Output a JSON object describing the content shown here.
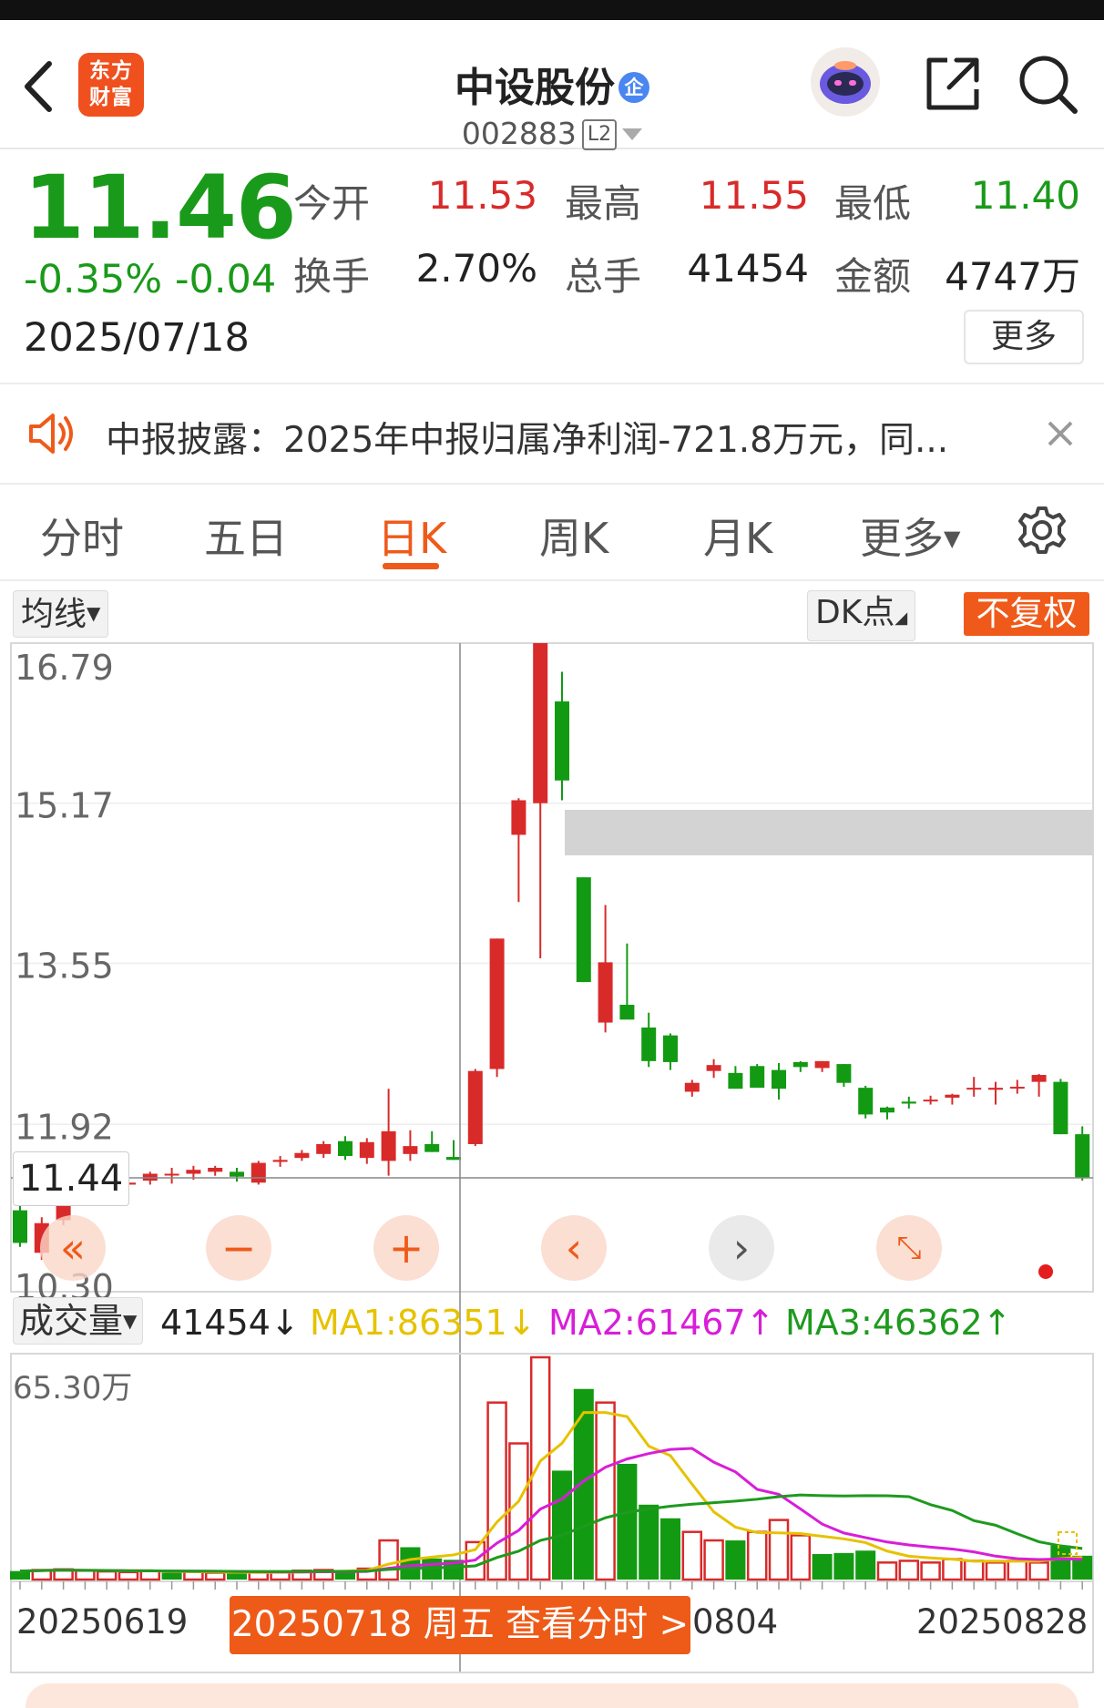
{
  "header": {
    "title": "中设股份",
    "title_badge": "企",
    "code": "002883",
    "level": "L2",
    "logo_text": "东方财富"
  },
  "quote": {
    "price": "11.46",
    "change_pct": "-0.35%",
    "change": "-0.04",
    "date": "2025/07/18",
    "open_label": "今开",
    "open": "11.53",
    "high_label": "最高",
    "high": "11.55",
    "low_label": "最低",
    "low": "11.40",
    "turnover_label": "换手",
    "turnover": "2.70%",
    "volume_label": "总手",
    "volume": "41454",
    "amount_label": "金额",
    "amount": "4747万",
    "more_label": "更多"
  },
  "notice": {
    "text": "中报披露：2025年中报归属净利润-721.8万元，同..."
  },
  "tabs": [
    "分时",
    "五日",
    "日K",
    "周K",
    "月K",
    "更多"
  ],
  "active_tab": "日K",
  "toolbar": {
    "ma_select": "均线",
    "dk_label": "DK点",
    "adjust_label": "不复权"
  },
  "chart_data": {
    "type": "candlestick",
    "y_ticks": [
      "16.79",
      "15.17",
      "13.55",
      "11.92",
      "10.30"
    ],
    "ylim": [
      10.3,
      16.79
    ],
    "crosshair_value": "11.44",
    "crosshair_date": "20250718 周五 查看分时 >",
    "x_labels": [
      "20250619",
      "0804",
      "20250828"
    ],
    "candles": [
      {
        "o": 11.05,
        "h": 11.12,
        "l": 10.68,
        "c": 10.72
      },
      {
        "o": 10.62,
        "h": 10.98,
        "l": 10.55,
        "c": 10.92
      },
      {
        "o": 10.95,
        "h": 11.32,
        "l": 10.9,
        "c": 11.28
      },
      {
        "o": 11.26,
        "h": 11.38,
        "l": 11.18,
        "c": 11.3
      },
      {
        "o": 11.3,
        "h": 11.36,
        "l": 11.25,
        "c": 11.3
      },
      {
        "o": 11.31,
        "h": 11.36,
        "l": 11.26,
        "c": 11.33
      },
      {
        "o": 11.35,
        "h": 11.44,
        "l": 11.31,
        "c": 11.42
      },
      {
        "o": 11.42,
        "h": 11.48,
        "l": 11.32,
        "c": 11.42
      },
      {
        "o": 11.42,
        "h": 11.5,
        "l": 11.36,
        "c": 11.46
      },
      {
        "o": 11.44,
        "h": 11.5,
        "l": 11.4,
        "c": 11.48
      },
      {
        "o": 11.44,
        "h": 11.48,
        "l": 11.34,
        "c": 11.39
      },
      {
        "o": 11.33,
        "h": 11.55,
        "l": 11.31,
        "c": 11.53
      },
      {
        "o": 11.54,
        "h": 11.6,
        "l": 11.49,
        "c": 11.56
      },
      {
        "o": 11.58,
        "h": 11.66,
        "l": 11.55,
        "c": 11.63
      },
      {
        "o": 11.62,
        "h": 11.75,
        "l": 11.58,
        "c": 11.72
      },
      {
        "o": 11.75,
        "h": 11.8,
        "l": 11.56,
        "c": 11.6
      },
      {
        "o": 11.58,
        "h": 11.78,
        "l": 11.52,
        "c": 11.74
      },
      {
        "o": 11.55,
        "h": 12.28,
        "l": 11.4,
        "c": 11.85
      },
      {
        "o": 11.62,
        "h": 11.86,
        "l": 11.55,
        "c": 11.7
      },
      {
        "o": 11.72,
        "h": 11.85,
        "l": 11.64,
        "c": 11.64
      },
      {
        "o": 11.59,
        "h": 11.76,
        "l": 11.56,
        "c": 11.56
      },
      {
        "o": 11.72,
        "h": 12.48,
        "l": 11.7,
        "c": 12.46
      },
      {
        "o": 12.48,
        "h": 13.8,
        "l": 12.4,
        "c": 13.8
      },
      {
        "o": 14.85,
        "h": 15.22,
        "l": 14.17,
        "c": 15.2
      },
      {
        "o": 15.17,
        "h": 16.79,
        "l": 13.6,
        "c": 16.79
      },
      {
        "o": 16.2,
        "h": 16.5,
        "l": 15.2,
        "c": 15.4
      },
      {
        "o": 14.42,
        "h": 14.42,
        "l": 13.36,
        "c": 13.36
      },
      {
        "o": 12.95,
        "h": 14.14,
        "l": 12.85,
        "c": 13.56
      },
      {
        "o": 13.13,
        "h": 13.75,
        "l": 13.0,
        "c": 12.98
      },
      {
        "o": 12.9,
        "h": 13.05,
        "l": 12.5,
        "c": 12.56
      },
      {
        "o": 12.82,
        "h": 12.84,
        "l": 12.47,
        "c": 12.55
      },
      {
        "o": 12.25,
        "h": 12.37,
        "l": 12.2,
        "c": 12.34
      },
      {
        "o": 12.46,
        "h": 12.58,
        "l": 12.39,
        "c": 12.52
      },
      {
        "o": 12.44,
        "h": 12.51,
        "l": 12.37,
        "c": 12.28
      },
      {
        "o": 12.51,
        "h": 12.53,
        "l": 12.31,
        "c": 12.29
      },
      {
        "o": 12.47,
        "h": 12.54,
        "l": 12.17,
        "c": 12.28
      },
      {
        "o": 12.55,
        "h": 12.56,
        "l": 12.45,
        "c": 12.5
      },
      {
        "o": 12.49,
        "h": 12.56,
        "l": 12.45,
        "c": 12.56
      },
      {
        "o": 12.53,
        "h": 12.53,
        "l": 12.3,
        "c": 12.34
      },
      {
        "o": 12.29,
        "h": 12.31,
        "l": 11.98,
        "c": 12.02
      },
      {
        "o": 12.09,
        "h": 12.1,
        "l": 11.97,
        "c": 12.04
      },
      {
        "o": 12.15,
        "h": 12.2,
        "l": 12.08,
        "c": 12.13
      },
      {
        "o": 12.16,
        "h": 12.21,
        "l": 12.12,
        "c": 12.17
      },
      {
        "o": 12.19,
        "h": 12.23,
        "l": 12.12,
        "c": 12.22
      },
      {
        "o": 12.28,
        "h": 12.4,
        "l": 12.2,
        "c": 12.29
      },
      {
        "o": 12.27,
        "h": 12.35,
        "l": 12.12,
        "c": 12.29
      },
      {
        "o": 12.3,
        "h": 12.37,
        "l": 12.23,
        "c": 12.3
      },
      {
        "o": 12.35,
        "h": 12.43,
        "l": 12.2,
        "c": 12.42
      },
      {
        "o": 12.35,
        "h": 12.38,
        "l": 11.82,
        "c": 11.82
      },
      {
        "o": 11.82,
        "h": 11.9,
        "l": 11.35,
        "c": 11.38
      }
    ]
  },
  "volume_data": {
    "label": "成交量",
    "current": "41454↓",
    "ma1": "MA1:86351↓",
    "ma2": "MA2:61467↑",
    "ma3": "MA3:46362↑",
    "ma_colors": {
      "ma1": "#e6c200",
      "ma2": "#d81ed8",
      "ma3": "#1e9a1e"
    },
    "max_label": "65.30万",
    "max_value": 65.3,
    "bars": [
      {
        "v": 2.5,
        "up": false
      },
      {
        "v": 2.8,
        "up": true
      },
      {
        "v": 3.0,
        "up": true
      },
      {
        "v": 2.6,
        "up": true
      },
      {
        "v": 2.4,
        "up": true
      },
      {
        "v": 2.2,
        "up": true
      },
      {
        "v": 2.6,
        "up": true
      },
      {
        "v": 2.0,
        "up": false
      },
      {
        "v": 2.3,
        "up": true
      },
      {
        "v": 2.0,
        "up": true
      },
      {
        "v": 1.8,
        "up": false
      },
      {
        "v": 2.2,
        "up": true
      },
      {
        "v": 2.3,
        "up": true
      },
      {
        "v": 2.6,
        "up": true
      },
      {
        "v": 2.8,
        "up": true
      },
      {
        "v": 2.5,
        "up": false
      },
      {
        "v": 3.2,
        "up": true
      },
      {
        "v": 11.5,
        "up": true
      },
      {
        "v": 9.5,
        "up": false
      },
      {
        "v": 6.2,
        "up": false
      },
      {
        "v": 5.8,
        "up": false
      },
      {
        "v": 11.0,
        "up": true
      },
      {
        "v": 52.0,
        "up": true
      },
      {
        "v": 40.0,
        "up": true
      },
      {
        "v": 65.3,
        "up": true
      },
      {
        "v": 32.0,
        "up": false
      },
      {
        "v": 56.0,
        "up": false
      },
      {
        "v": 52.0,
        "up": true
      },
      {
        "v": 34.0,
        "up": false
      },
      {
        "v": 22.0,
        "up": false
      },
      {
        "v": 18.0,
        "up": false
      },
      {
        "v": 14.0,
        "up": true
      },
      {
        "v": 11.5,
        "up": true
      },
      {
        "v": 11.5,
        "up": false
      },
      {
        "v": 14.0,
        "up": true
      },
      {
        "v": 17.5,
        "up": true
      },
      {
        "v": 13.0,
        "up": true
      },
      {
        "v": 7.5,
        "up": false
      },
      {
        "v": 7.8,
        "up": false
      },
      {
        "v": 8.5,
        "up": false
      },
      {
        "v": 5.0,
        "up": true
      },
      {
        "v": 5.5,
        "up": true
      },
      {
        "v": 5.0,
        "up": true
      },
      {
        "v": 6.0,
        "up": true
      },
      {
        "v": 5.5,
        "up": true
      },
      {
        "v": 5.0,
        "up": true
      },
      {
        "v": 5.5,
        "up": true
      },
      {
        "v": 5.0,
        "up": true
      },
      {
        "v": 10.0,
        "up": false
      },
      {
        "v": 7.0,
        "up": false
      }
    ]
  },
  "colors": {
    "up": "#d92a2a",
    "down": "#139a13",
    "accent": "#ef5a1a"
  }
}
